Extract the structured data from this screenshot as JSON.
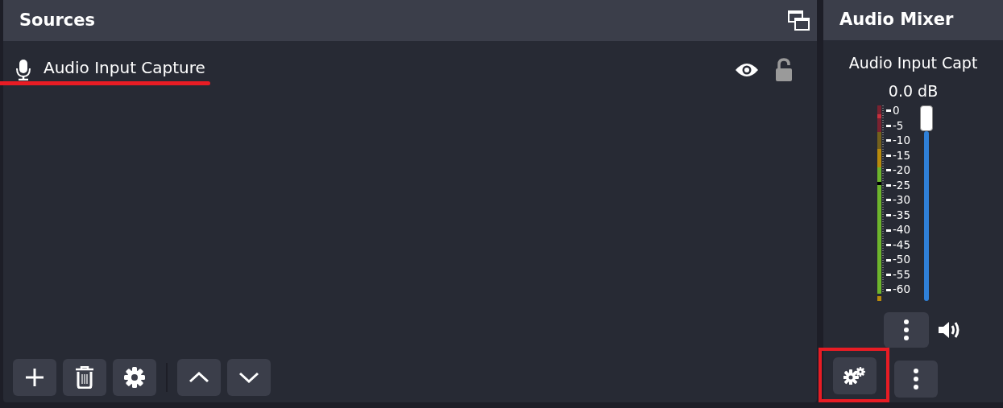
{
  "sources_panel": {
    "title": "Sources",
    "items": [
      {
        "name": "Audio Input Capture",
        "visible": true,
        "locked": false,
        "underlined": true
      }
    ],
    "toolbar": [
      {
        "kind": "add"
      },
      {
        "kind": "remove"
      },
      {
        "kind": "properties"
      },
      {
        "kind": "separator"
      },
      {
        "kind": "up"
      },
      {
        "kind": "down"
      }
    ]
  },
  "audio_mixer": {
    "title": "Audio Mixer",
    "channel": {
      "name": "Audio Input Capt",
      "reading": "0.0 dB",
      "scale": [
        "0",
        "-5",
        "-10",
        "-15",
        "-20",
        "-25",
        "-30",
        "-35",
        "-40",
        "-45",
        "-50",
        "-55",
        "-60"
      ],
      "level": 1,
      "muted": false
    },
    "toolbar": [
      {
        "kind": "advanced",
        "highlighted": true
      },
      {
        "kind": "menu",
        "highlighted": false
      }
    ]
  }
}
